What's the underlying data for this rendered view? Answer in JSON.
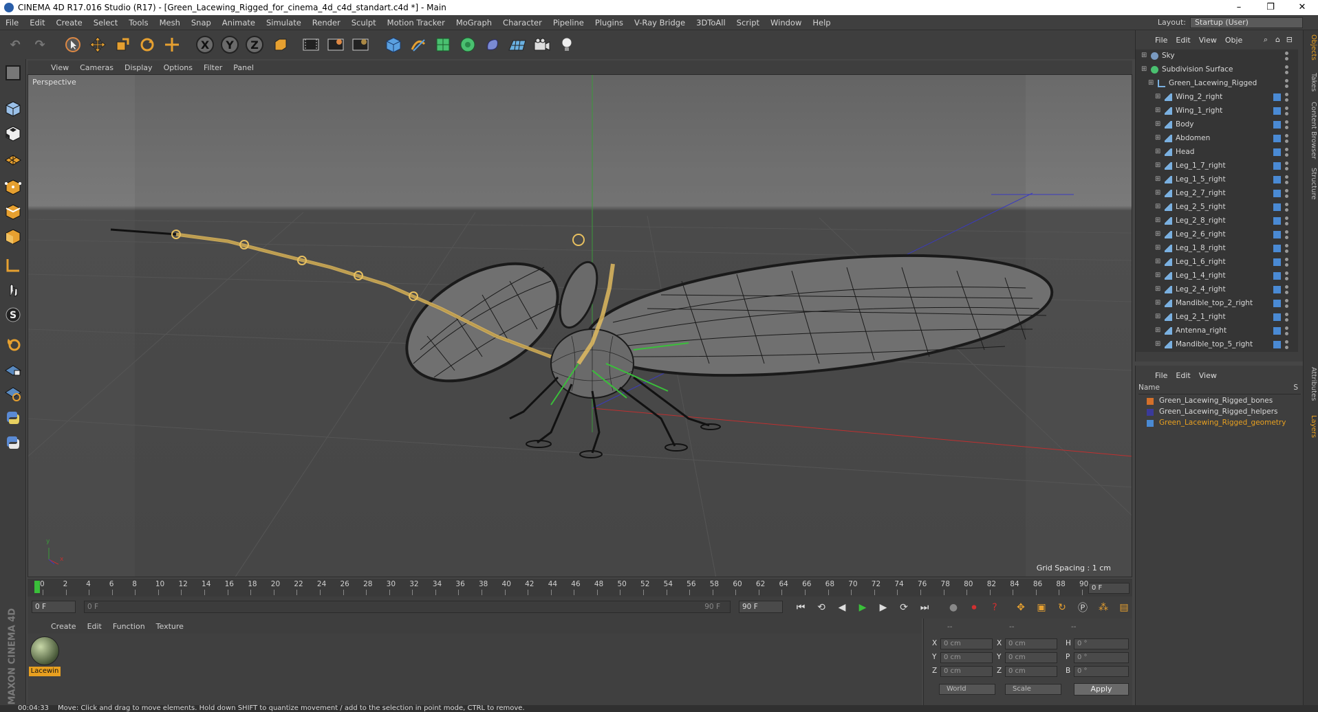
{
  "window": {
    "title": "CINEMA 4D R17.016 Studio (R17) - [Green_Lacewing_Rigged_for_cinema_4d_c4d_standart.c4d *] - Main",
    "minimize": "–",
    "restore": "❐",
    "close": "✕"
  },
  "menu": [
    "File",
    "Edit",
    "Create",
    "Select",
    "Tools",
    "Mesh",
    "Snap",
    "Animate",
    "Simulate",
    "Render",
    "Sculpt",
    "Motion Tracker",
    "MoGraph",
    "Character",
    "Pipeline",
    "Plugins",
    "V-Ray Bridge",
    "3DToAll",
    "Script",
    "Window",
    "Help"
  ],
  "layout": {
    "label": "Layout:",
    "value": "Startup (User)"
  },
  "toolbar": {
    "x_label": "X",
    "y_label": "Y",
    "z_label": "Z"
  },
  "viewport": {
    "menu": [
      "View",
      "Cameras",
      "Display",
      "Options",
      "Filter",
      "Panel"
    ],
    "label": "Perspective",
    "grid_spacing": "Grid Spacing : 1 cm",
    "axis_x": "x",
    "axis_y": "y"
  },
  "timeline": {
    "ticks": [
      "0",
      "2",
      "4",
      "6",
      "8",
      "10",
      "12",
      "14",
      "16",
      "18",
      "20",
      "22",
      "24",
      "26",
      "28",
      "30",
      "32",
      "34",
      "36",
      "38",
      "40",
      "42",
      "44",
      "46",
      "48",
      "50",
      "52",
      "54",
      "56",
      "58",
      "60",
      "62",
      "64",
      "66",
      "68",
      "70",
      "72",
      "74",
      "76",
      "78",
      "80",
      "82",
      "84",
      "86",
      "88",
      "90"
    ],
    "current_frame": "0 F",
    "start_field": "0 F",
    "range_start": "0 F",
    "range_end": "90 F",
    "end_field": "90 F"
  },
  "materials": {
    "menu": [
      "Create",
      "Edit",
      "Function",
      "Texture"
    ],
    "items": [
      {
        "name": "Lacewin"
      }
    ]
  },
  "coordinates": {
    "header": [
      "--",
      "--",
      "--"
    ],
    "rows": [
      {
        "a": "X",
        "av": "0 cm",
        "b": "X",
        "bv": "0 cm",
        "c": "H",
        "cv": "0 °"
      },
      {
        "a": "Y",
        "av": "0 cm",
        "b": "Y",
        "bv": "0 cm",
        "c": "P",
        "cv": "0 °"
      },
      {
        "a": "Z",
        "av": "0 cm",
        "b": "Z",
        "bv": "0 cm",
        "c": "B",
        "cv": "0 °"
      }
    ],
    "mode1": "World",
    "mode2": "Scale",
    "apply": "Apply"
  },
  "objects": {
    "menu": [
      "File",
      "Edit",
      "View",
      "Obje"
    ],
    "items": [
      {
        "name": "Sky",
        "level": 0
      },
      {
        "name": "Subdivision Surface",
        "level": 0
      },
      {
        "name": "Green_Lacewing_Rigged",
        "level": 1
      },
      {
        "name": "Wing_2_right",
        "level": 2
      },
      {
        "name": "Wing_1_right",
        "level": 2
      },
      {
        "name": "Body",
        "level": 2
      },
      {
        "name": "Abdomen",
        "level": 2
      },
      {
        "name": "Head",
        "level": 2
      },
      {
        "name": "Leg_1_7_right",
        "level": 2
      },
      {
        "name": "Leg_1_5_right",
        "level": 2
      },
      {
        "name": "Leg_2_7_right",
        "level": 2
      },
      {
        "name": "Leg_2_5_right",
        "level": 2
      },
      {
        "name": "Leg_2_8_right",
        "level": 2
      },
      {
        "name": "Leg_2_6_right",
        "level": 2
      },
      {
        "name": "Leg_1_8_right",
        "level": 2
      },
      {
        "name": "Leg_1_6_right",
        "level": 2
      },
      {
        "name": "Leg_1_4_right",
        "level": 2
      },
      {
        "name": "Leg_2_4_right",
        "level": 2
      },
      {
        "name": "Mandible_top_2_right",
        "level": 2
      },
      {
        "name": "Leg_2_1_right",
        "level": 2
      },
      {
        "name": "Antenna_right",
        "level": 2
      },
      {
        "name": "Mandible_top_5_right",
        "level": 2
      }
    ]
  },
  "layers": {
    "menu": [
      "File",
      "Edit",
      "View"
    ],
    "header_name": "Name",
    "header_s": "S",
    "items": [
      {
        "name": "Green_Lacewing_Rigged_bones",
        "color": "#d4702a"
      },
      {
        "name": "Green_Lacewing_Rigged_helpers",
        "color": "#3a3a9a"
      },
      {
        "name": "Green_Lacewing_Rigged_geometry",
        "color": "#4a8ad4"
      }
    ]
  },
  "right_tabs": [
    "Objects",
    "Takes",
    "Content Browser",
    "Structure",
    "Attributes",
    "Layers"
  ],
  "status": {
    "time": "00:04:33",
    "message": "Move: Click and drag to move elements. Hold down SHIFT to quantize movement / add to the selection in point mode, CTRL to remove."
  },
  "brand": "MAXON CINEMA 4D"
}
